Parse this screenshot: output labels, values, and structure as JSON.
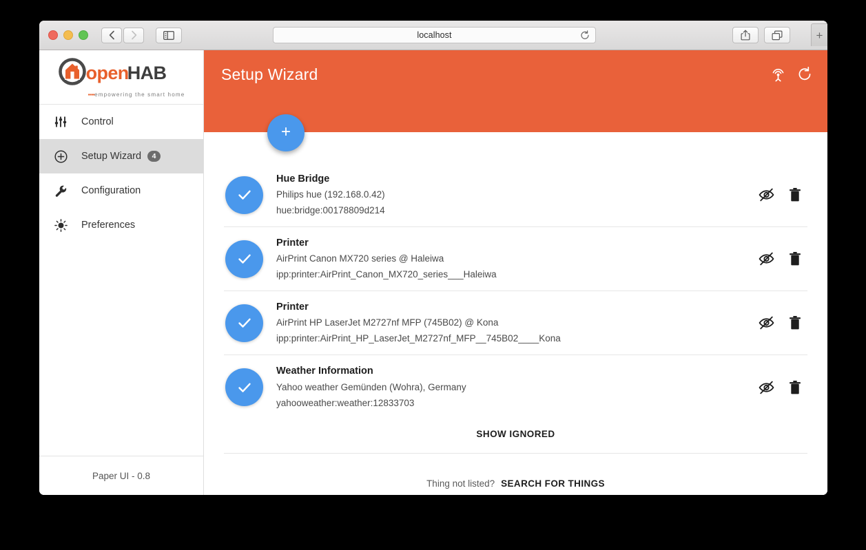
{
  "browser": {
    "url_value": "localhost",
    "nav_back_icon": "chevron-left-icon",
    "nav_forward_icon": "chevron-right-icon",
    "sidebar_toggle_icon": "sidebar-panel-icon",
    "reload_icon": "reload-icon",
    "share_icon": "share-icon",
    "tabs_icon": "show-tabs-icon",
    "new_tab_label": "+"
  },
  "sidebar": {
    "logo": {
      "word_open": "open",
      "word_hab": "HAB",
      "tagline_dots": "▪▪▪▪",
      "tagline": "empowering the smart home"
    },
    "items": [
      {
        "label": "Control",
        "icon": "sliders-icon",
        "badge": null,
        "active": false
      },
      {
        "label": "Setup Wizard",
        "icon": "plus-circle-icon",
        "badge": "4",
        "active": true
      },
      {
        "label": "Configuration",
        "icon": "wrench-icon",
        "badge": null,
        "active": false
      },
      {
        "label": "Preferences",
        "icon": "brightness-icon",
        "badge": null,
        "active": false
      }
    ],
    "footer": "Paper UI - 0.8"
  },
  "header": {
    "title": "Setup Wizard",
    "discovery_icon": "broadcast-antenna-icon",
    "refresh_icon": "refresh-icon",
    "accent_color": "#e9613a"
  },
  "fab": {
    "label": "+",
    "icon": "plus-icon",
    "color": "#4a98ec"
  },
  "things": [
    {
      "title": "Hue Bridge",
      "subtitle": "Philips hue (192.168.0.42)",
      "uid": "hue:bridge:00178809d214",
      "avatar_icon": "check-icon",
      "hide_icon": "eye-off-icon",
      "delete_icon": "trash-icon"
    },
    {
      "title": "Printer",
      "subtitle": "AirPrint Canon MX720 series @ Haleiwa",
      "uid": "ipp:printer:AirPrint_Canon_MX720_series___Haleiwa",
      "avatar_icon": "check-icon",
      "hide_icon": "eye-off-icon",
      "delete_icon": "trash-icon"
    },
    {
      "title": "Printer",
      "subtitle": "AirPrint HP LaserJet M2727nf MFP (745B02) @ Kona",
      "uid": "ipp:printer:AirPrint_HP_LaserJet_M2727nf_MFP__745B02____Kona",
      "avatar_icon": "check-icon",
      "hide_icon": "eye-off-icon",
      "delete_icon": "trash-icon"
    },
    {
      "title": "Weather Information",
      "subtitle": "Yahoo weather Gemünden (Wohra), Germany",
      "uid": "yahooweather:weather:12833703",
      "avatar_icon": "check-icon",
      "hide_icon": "eye-off-icon",
      "delete_icon": "trash-icon"
    }
  ],
  "actions": {
    "show_ignored": "SHOW IGNORED",
    "thing_not_listed": "Thing not listed?",
    "search_for_things": "SEARCH FOR THINGS"
  }
}
